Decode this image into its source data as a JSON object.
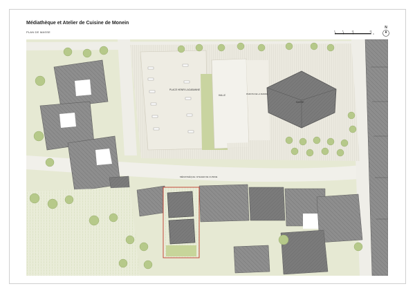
{
  "title": "Médiathèque et Atelier de Cuisine de Monein",
  "subtitle": "PLAN DE MASSE",
  "scale_bar": {
    "labels": [
      "0",
      "5",
      "10",
      "20"
    ],
    "unit": "m"
  },
  "north_label": "N",
  "map_labels": {
    "place": "PLACE HENRI LACABANNE",
    "halle": "HALLE",
    "parvis": "PARVIS DE LA MAIRIE",
    "mairie": "MAIRIE",
    "mediatheque": "MÉDIATHÈQUE / ATELIER DE CUISINE"
  },
  "colors": {
    "building_roof": "#8c8c8c",
    "building_roof_dark": "#6f6f6f",
    "green_space": "#dfe8c8",
    "paving": "#eceae1",
    "trees": "#b6c98a",
    "project_outline": "#c0392b"
  }
}
